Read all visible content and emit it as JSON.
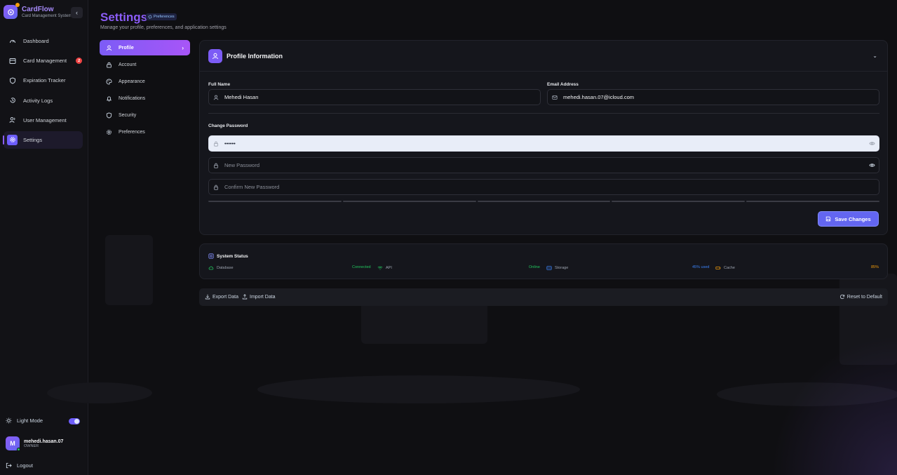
{
  "brand": {
    "name": "CardFlow",
    "subtitle": "Card Management System"
  },
  "sidebar": {
    "items": [
      {
        "label": "Dashboard",
        "icon": "gauge-icon"
      },
      {
        "label": "Card Management",
        "icon": "card-icon",
        "badge": "2"
      },
      {
        "label": "Expiration Tracker",
        "icon": "shield-icon"
      },
      {
        "label": "Activity Logs",
        "icon": "history-icon"
      },
      {
        "label": "User Management",
        "icon": "users-icon"
      },
      {
        "label": "Settings",
        "icon": "gear-icon",
        "active": true
      }
    ],
    "light_mode_label": "Light Mode",
    "user": {
      "initial": "M",
      "name": "mehedi.hasan.07",
      "role": "OWNER"
    },
    "logout_label": "Logout"
  },
  "header": {
    "title": "Settings",
    "chip": "Preferences",
    "subtitle": "Manage your profile, preferences, and application settings"
  },
  "tabs": [
    "Profile",
    "Account",
    "Appearance",
    "Notifications",
    "Security",
    "Preferences"
  ],
  "profile": {
    "title": "Profile Information",
    "full_name_label": "Full Name",
    "full_name_value": "Mehedi Hasan",
    "email_label": "Email Address",
    "email_value": "mehedi.hasan.07@icloud.com",
    "change_password_label": "Change Password",
    "current_password_value": "••••••",
    "new_password_placeholder": "New Password",
    "confirm_password_placeholder": "Confirm New Password",
    "save_label": "Save Changes"
  },
  "system_status": {
    "title": "System Status",
    "items": [
      {
        "label": "Database",
        "value": "Connected",
        "color": "#22c55e"
      },
      {
        "label": "API",
        "value": "Online",
        "color": "#22c55e"
      },
      {
        "label": "Storage",
        "value": "45% used",
        "color": "#3b82f6"
      },
      {
        "label": "Cache",
        "value": "85%",
        "color": "#f59e0b"
      }
    ]
  },
  "data_actions": {
    "export_label": "Export Data",
    "import_label": "Import Data",
    "reset_label": "Reset to Default"
  },
  "colors": {
    "accent": "#8b5cf6",
    "indigo": "#6366f1",
    "danger": "#ef4444",
    "success": "#22c55e"
  }
}
